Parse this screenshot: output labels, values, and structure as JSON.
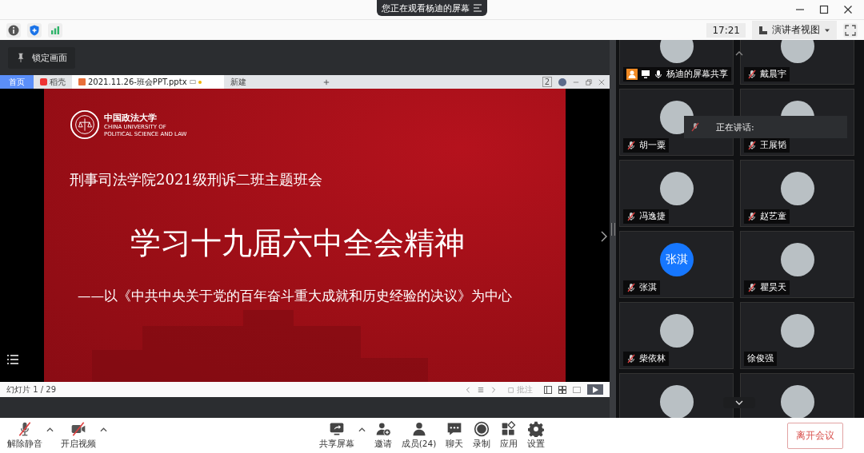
{
  "title_bar": {
    "notice": "您正在观看杨迪的屏幕"
  },
  "toolbar": {
    "time": "17:21",
    "view_mode": "演讲者视图"
  },
  "lock_button": "锁定画面",
  "shared_screen": {
    "tabs": [
      {
        "label": "首页",
        "kind": "home",
        "selected": false
      },
      {
        "label": "稻壳",
        "kind": "docer",
        "selected": false
      },
      {
        "label": "2021.11.26-班会PPT.pptx",
        "kind": "document",
        "selected": true
      },
      {
        "label": "新建",
        "kind": "new",
        "selected": false
      }
    ],
    "window_count": "2",
    "slide": {
      "logo_name": "中国政法大学",
      "logo_english": "CHINA UNIVERSITY OF POLITICAL SCIENCE AND LAW",
      "kicker": "刑事司法学院2021级刑诉二班主题班会",
      "title": "学习十九届六中全会精神",
      "subtitle": "——以《中共中央关于党的百年奋斗重大成就和历史经验的决议》为中心"
    },
    "status": {
      "slide_counter": "幻灯片 1 / 29",
      "notes": "批注"
    }
  },
  "participants": [
    {
      "name": "杨迪的屏幕共享",
      "kind": "screen_share",
      "avatar": {
        "kind": "photo"
      },
      "muted": false
    },
    {
      "name": "戴晨宇",
      "kind": "person",
      "avatar": {
        "kind": "photo"
      },
      "muted": true
    },
    {
      "name": "胡一粟",
      "kind": "person",
      "avatar": {
        "kind": "photo"
      },
      "muted": true
    },
    {
      "name": "王展韬",
      "kind": "person",
      "avatar": {
        "kind": "photo"
      },
      "muted": true
    },
    {
      "name": "冯逸捷",
      "kind": "person",
      "avatar": {
        "kind": "photo"
      },
      "muted": true
    },
    {
      "name": "赵艺童",
      "kind": "person",
      "avatar": {
        "kind": "photo"
      },
      "muted": true
    },
    {
      "name": "张淇",
      "kind": "person",
      "avatar": {
        "kind": "initials",
        "text": "张淇"
      },
      "muted": true
    },
    {
      "name": "瞿昊天",
      "kind": "person",
      "avatar": {
        "kind": "photo"
      },
      "muted": true
    },
    {
      "name": "柴依林",
      "kind": "person",
      "avatar": {
        "kind": "photo"
      },
      "muted": true
    },
    {
      "name": "徐俊强",
      "kind": "person",
      "avatar": {
        "kind": "photo"
      },
      "muted": false
    },
    {
      "avatar": {
        "kind": "photo"
      }
    },
    {
      "avatar": {
        "kind": "photo"
      }
    }
  ],
  "speaking": {
    "label": "正在讲话:"
  },
  "controls": [
    {
      "label": "解除静音",
      "kind": "mic",
      "off": true,
      "has_menu": true
    },
    {
      "label": "开启视频",
      "kind": "video",
      "off": true,
      "has_menu": true
    },
    {
      "label": "共享屏幕",
      "kind": "share",
      "off": false,
      "has_menu": true
    },
    {
      "label": "邀请",
      "kind": "invite",
      "off": false,
      "has_menu": false
    },
    {
      "label": "成员(24)",
      "kind": "members",
      "off": false,
      "has_menu": false
    },
    {
      "label": "聊天",
      "kind": "chat",
      "off": false,
      "has_menu": false
    },
    {
      "label": "录制",
      "kind": "record",
      "off": false,
      "has_menu": false
    },
    {
      "label": "应用",
      "kind": "apps",
      "off": false,
      "has_menu": false
    },
    {
      "label": "设置",
      "kind": "settings",
      "off": false,
      "has_menu": false
    }
  ],
  "leave_button": "离开会议"
}
